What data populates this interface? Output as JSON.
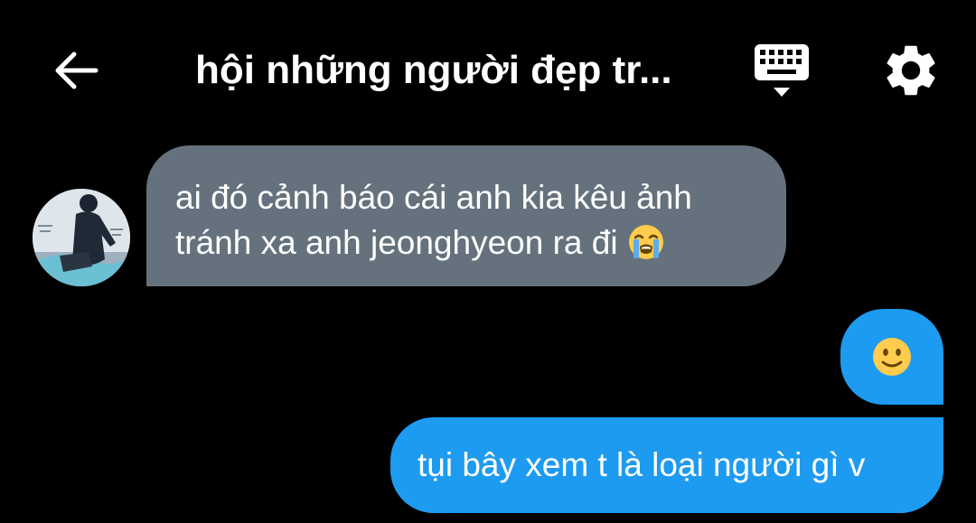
{
  "header": {
    "title": "hội những người đẹp tr...",
    "back_icon": "arrow-left-icon",
    "keyboard_icon": "keyboard-icon",
    "settings_icon": "gear-icon"
  },
  "messages": [
    {
      "sender": "other",
      "lines": [
        "ai đó cảnh báo cái anh kia kêu ảnh",
        "tránh xa anh jeonghyeon ra đi"
      ],
      "emoji": "loudly-crying-face-emoji"
    },
    {
      "sender": "me",
      "emoji": "slightly-smiling-face-emoji"
    },
    {
      "sender": "me",
      "text": "tụi bây xem t là loại người gì v"
    }
  ],
  "colors": {
    "background": "#000000",
    "incoming_bubble": "#65727d",
    "outgoing_bubble": "#1d9bf0",
    "text": "#ffffff"
  }
}
